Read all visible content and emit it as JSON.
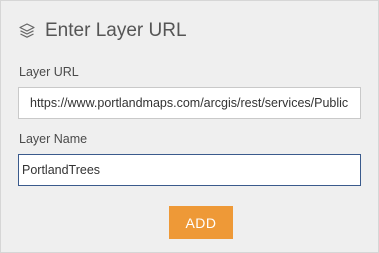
{
  "header": {
    "icon": "layers-icon",
    "title": "Enter Layer URL"
  },
  "form": {
    "url_label": "Layer URL",
    "url_value": "https://www.portlandmaps.com/arcgis/rest/services/Public",
    "name_label": "Layer Name",
    "name_value": "PortlandTrees",
    "add_label": "ADD"
  },
  "colors": {
    "panel_bg": "#efefef",
    "accent_button": "#ee9937",
    "focus_border": "#3a5a8c"
  }
}
